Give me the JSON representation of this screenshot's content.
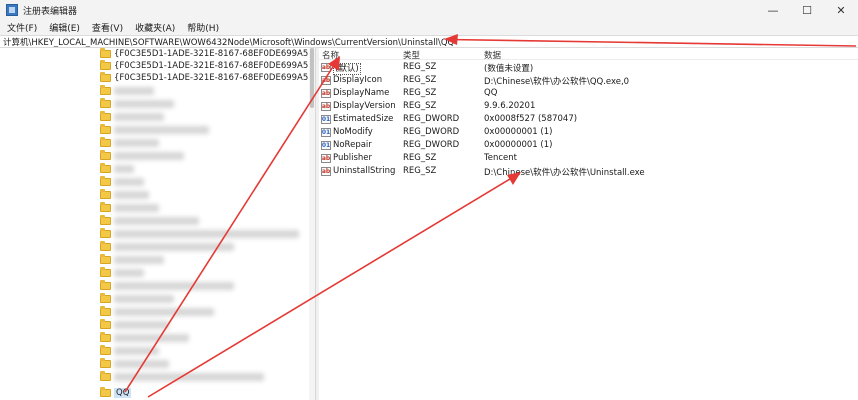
{
  "window": {
    "title": "注册表编辑器",
    "controls": {
      "minimize": "—",
      "maximize": "☐",
      "close": "✕"
    }
  },
  "menu": [
    "文件(F)",
    "编辑(E)",
    "查看(V)",
    "收藏夹(A)",
    "帮助(H)"
  ],
  "address": "计算机\\HKEY_LOCAL_MACHINE\\SOFTWARE\\WOW6432Node\\Microsoft\\Windows\\CurrentVersion\\Uninstall\\QQ",
  "tree": {
    "visible_keys": [
      "{F0C3E5D1-1ADE-321E-8167-68EF0DE699A5}.K",
      "{F0C3E5D1-1ADE-321E-8167-68EF0DE699A5}.K",
      "{F0C3E5D1-1ADE-321E-8167-68EF0DE699A5}.K"
    ],
    "selected": "QQ"
  },
  "values": {
    "columns": [
      "名称",
      "类型",
      "数据"
    ],
    "rows": [
      {
        "name": "(默认)",
        "type": "REG_SZ",
        "data": "(数值未设置)",
        "icon": "string-value-icon"
      },
      {
        "name": "DisplayIcon",
        "type": "REG_SZ",
        "data": "D:\\Chinese\\软件\\办公软件\\QQ.exe,0",
        "icon": "string-value-icon"
      },
      {
        "name": "DisplayName",
        "type": "REG_SZ",
        "data": "QQ",
        "icon": "string-value-icon"
      },
      {
        "name": "DisplayVersion",
        "type": "REG_SZ",
        "data": "9.9.6.20201",
        "icon": "string-value-icon"
      },
      {
        "name": "EstimatedSize",
        "type": "REG_DWORD",
        "data": "0x0008f527 (587047)",
        "icon": "dword-value-icon"
      },
      {
        "name": "NoModify",
        "type": "REG_DWORD",
        "data": "0x00000001 (1)",
        "icon": "dword-value-icon"
      },
      {
        "name": "NoRepair",
        "type": "REG_DWORD",
        "data": "0x00000001 (1)",
        "icon": "dword-value-icon"
      },
      {
        "name": "Publisher",
        "type": "REG_SZ",
        "data": "Tencent",
        "icon": "string-value-icon"
      },
      {
        "name": "UninstallString",
        "type": "REG_SZ",
        "data": "D:\\Chinese\\软件\\办公软件\\Uninstall.exe",
        "icon": "string-value-icon"
      }
    ]
  },
  "colors": {
    "annotation_arrow": "#e53935",
    "folder": "#f3c846",
    "selection": "#cde3f8"
  }
}
